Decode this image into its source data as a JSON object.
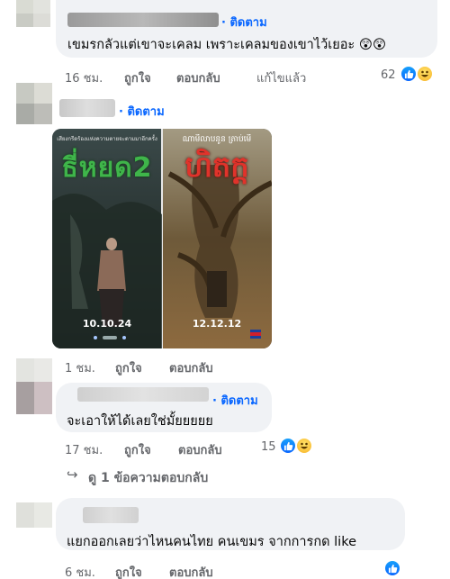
{
  "comments": [
    {
      "follow_label": "· ติดตาม",
      "text": "เขมรกลัวแต่เขาจะเคลม เพราะเคลมของเขาไว้เยอะ 😲😲",
      "time": "16 ชม.",
      "like_label": "ถูกใจ",
      "reply_label": "ตอบกลับ",
      "edited_label": "แก้ไขแล้ว",
      "reaction_count": "62",
      "reactions": [
        "like-icon",
        "haha-icon"
      ]
    },
    {
      "follow_label": "· ติดตาม",
      "image_alt": "Two movie posters side by side",
      "poster_left": {
        "title": "ธี่หยด2",
        "tagline": "เสียงกรีดร้องแห่งความตายจะตามมาอีกครั้ง",
        "date": "10.10.24"
      },
      "poster_right": {
        "title": "ហិតក្ត",
        "tagline": "ណាមីលាបនូន ត្រាប់មើ",
        "date": "12.12.12"
      },
      "time": "1 ชม.",
      "like_label": "ถูกใจ",
      "reply_label": "ตอบกลับ"
    },
    {
      "follow_label": "· ติดตาม",
      "text": "จะเอาให้ได้เลยใช่มั้ยยยยย",
      "time": "17 ชม.",
      "like_label": "ถูกใจ",
      "reply_label": "ตอบกลับ",
      "reaction_count": "15",
      "reactions": [
        "like-icon",
        "haha-icon"
      ],
      "view_replies": "ดู 1 ข้อความตอบกลับ"
    },
    {
      "text": "แยกออกเลยว่าไหนคนไทย คนเขมร จากการกด like",
      "time": "6 ชม.",
      "like_label": "ถูกใจ",
      "reply_label": "ตอบกลับ",
      "reactions": [
        "like-icon"
      ]
    }
  ],
  "colors": {
    "bubble": "#f0f2f5",
    "follow": "#0866ff",
    "meta": "#65676b",
    "like": "#0866ff"
  }
}
